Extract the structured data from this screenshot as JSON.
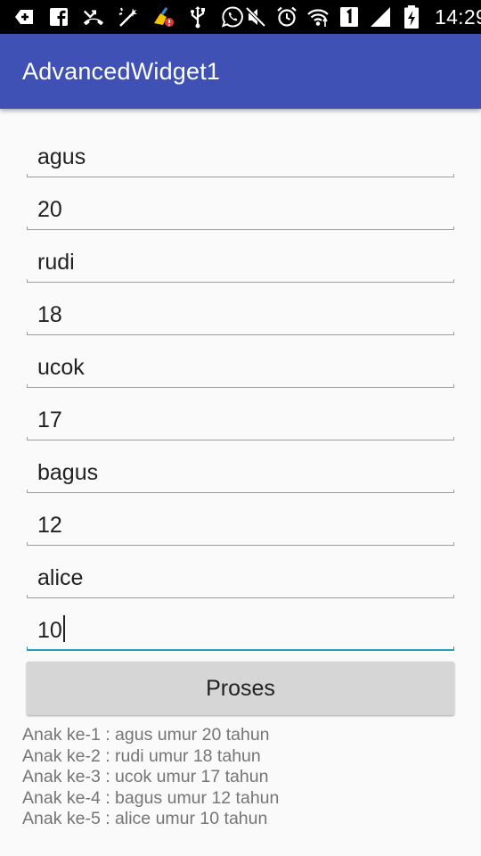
{
  "status_bar": {
    "icons_left": [
      "add-box-icon",
      "facebook-icon",
      "missed-call-icon",
      "no-signal-wand-icon",
      "cleaner-alert-icon",
      "usb-icon",
      "whatsapp-icon"
    ],
    "icons_right": [
      "mute-icon",
      "alarm-icon",
      "wifi-icon",
      "sim1-icon",
      "signal-icon",
      "battery-charging-icon"
    ],
    "time": "14:29"
  },
  "app_bar": {
    "title": "AdvancedWidget1",
    "color": "#3f51b5"
  },
  "form": {
    "fields": [
      {
        "value": "agus"
      },
      {
        "value": "20"
      },
      {
        "value": "rudi"
      },
      {
        "value": "18"
      },
      {
        "value": "ucok"
      },
      {
        "value": "17"
      },
      {
        "value": "bagus"
      },
      {
        "value": "12"
      },
      {
        "value": "alice"
      },
      {
        "value": "10"
      }
    ],
    "focus_color": "#26a0b5",
    "button_label": "Proses"
  },
  "result": {
    "lines": [
      "Anak ke-1 : agus umur 20 tahun",
      "Anak ke-2 : rudi umur 18 tahun",
      "Anak ke-3 : ucok umur 17 tahun",
      "Anak ke-4 : bagus umur 12 tahun",
      "Anak ke-5 : alice umur 10 tahun"
    ]
  }
}
